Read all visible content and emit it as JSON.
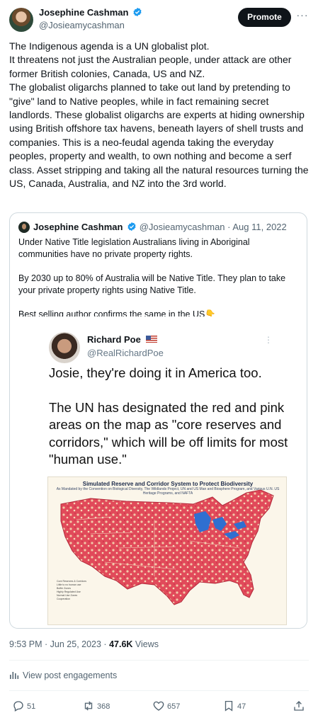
{
  "post": {
    "author_name": "Josephine Cashman",
    "author_handle": "@Josieamycashman",
    "promote_label": "Promote",
    "more_label": "···",
    "paragraphs": [
      "The Indigenous agenda is a UN globalist plot.",
      "It threatens not just the Australian people, under attack are other former British colonies, Canada, US and NZ.",
      "The globalist oligarchs planned to take out land by pretending to \"give\" land to Native peoples, while in fact remaining secret landlords. These globalist oligarchs are experts at hiding ownership using British offshore tax havens, beneath layers of shell trusts and companies. This is a neo-feudal agenda taking the everyday peoples, property and wealth, to own nothing and become a serf class. Asset stripping and taking all the natural resources turning the US, Canada, Australia, and NZ into the 3rd world."
    ],
    "time": "9:53 PM · Jun 25, 2023 · ",
    "views_count": "47.6K",
    "views_label": " Views",
    "engagements_label": "View post engagements"
  },
  "quote": {
    "author_name": "Josephine Cashman",
    "author_handle": "@Josieamycashman",
    "date": " · Aug 11, 2022",
    "paragraphs": [
      "Under Native Title legislation Australians living in Aboriginal communities have no private property rights.",
      "By 2030 up to 80% of Australia will be Native Title. They plan to take your private property rights using Native Title.",
      "Best selling author confirms the same in the US"
    ],
    "hand_emoji": "👇"
  },
  "embedded": {
    "name": "Richard Poe",
    "handle": "@RealRichardPoe",
    "more": "⋮",
    "paragraphs": [
      "Josie, they're doing it in America too.",
      "The UN has designated the red and pink areas on the map as \"core reserves and corridors,\" which will be off limits for most \"human use.\""
    ],
    "map_title": "Simulated Reserve and Corridor System to Protect Biodiversity",
    "map_subtitle": "As Mandated by the Convention on Biological Diversity, The Wildlands Project, UN and US Man and Biosphere Program, and Various U.N. US Heritage Programs, and NAFTA",
    "legend_lines": [
      "Core Reserves & Corridors",
      "Little to no human use",
      "Buffer Zones",
      "Highly Regulated Use",
      "Normal Use Zones",
      "Cooperation"
    ]
  },
  "actions": {
    "replies": "51",
    "reposts": "368",
    "likes": "657",
    "bookmarks": "47"
  },
  "colors": {
    "accent": "#1d9bf0",
    "text": "#0f1419",
    "muted": "#536471",
    "map_red": "#d8404f"
  }
}
